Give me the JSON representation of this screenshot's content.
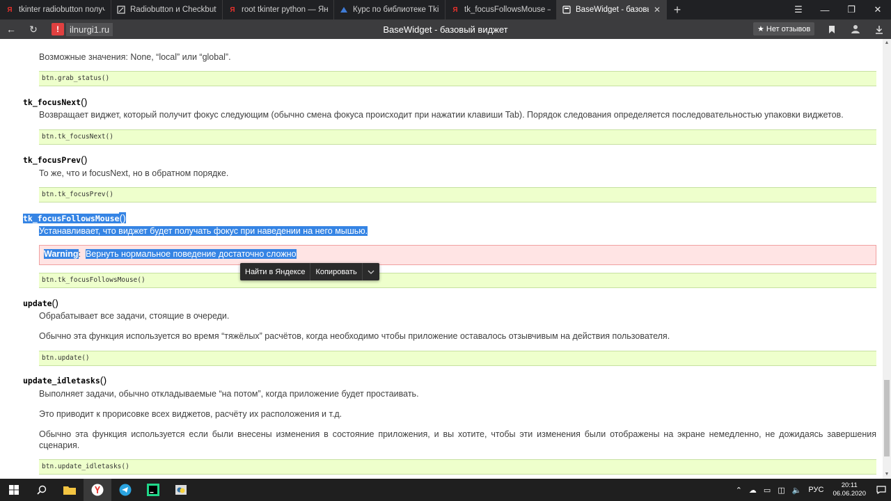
{
  "browser": {
    "tabs": [
      {
        "icon": "yandex-icon",
        "title": "tkinter radiobutton получи",
        "color": "#e8312c"
      },
      {
        "icon": "doc-icon",
        "title": "Radiobutton и Checkbutton",
        "color": "#ffffff"
      },
      {
        "icon": "yandex-icon",
        "title": "root tkinter python — Янде",
        "color": "#e8312c"
      },
      {
        "icon": "course-icon",
        "title": "Курс по библиотеке Tkinte",
        "color": "#3f7bd6"
      },
      {
        "icon": "yandex-icon",
        "title": "tk_focusFollowsMouse — Я",
        "color": "#e8312c"
      },
      {
        "icon": "page-icon",
        "title": "BaseWidget - базовый в",
        "color": "#ffffff"
      }
    ],
    "site_host": "ilnurgi1.ru",
    "page_title": "BaseWidget - базовый виджет",
    "reviews_label": "Нет отзывов"
  },
  "content": {
    "p_values": "Возможные значения: None, “local” или “global”.",
    "code_grab": "btn.grab_status()",
    "sig_focusnext": "tk_focusNext",
    "p_focusnext": "Возвращает виджет, который получит фокус следующим (обычно смена фокуса происходит при нажатии клавиши Tab). Порядок следования определяется последовательностью упаковки виджетов.",
    "code_focusnext": "btn.tk_focusNext()",
    "sig_focusprev": "tk_focusPrev",
    "p_focusprev": "То же, что и focusNext, но в обратном порядке.",
    "code_focusprev": "btn.tk_focusPrev()",
    "sig_follows": "tk_focusFollowsMouse",
    "p_follows": "Устанавливает, что виджет будет получать фокус при наведении на него мышью.",
    "warning_label": "Warning",
    "warning_text": "Вернуть нормальное поведение достаточно сложно",
    "code_follows": "btn.tk_focusFollowsMouse()",
    "sig_update": "update",
    "p_update1": "Обрабатывает все задачи, стоящие в очереди.",
    "p_update2": "Обычно эта функция используется во время “тяжёлых” расчётов, когда необходимо чтобы приложение оставалось отзывчивым на действия пользователя.",
    "code_update": "btn.update()",
    "sig_idle": "update_idletasks",
    "p_idle1": "Выполняет задачи, обычно откладываемые “на потом”, когда приложение будет простаивать.",
    "p_idle2": "Это приводит к прорисовке всех виджетов, расчёту их расположения и т.д.",
    "p_idle3": "Обычно эта функция используется если были внесены изменения в состояние приложения, и вы хотите, чтобы эти изменения были отображены на экране немедленно, не дожидаясь завершения сценария.",
    "code_idle": "btn.update_idletasks()"
  },
  "context_menu": {
    "search": "Найти в Яндексе",
    "copy": "Копировать"
  },
  "taskbar": {
    "lang": "РУС",
    "time": "20:11",
    "date": "06.06.2020"
  },
  "colors": {
    "code_bg": "#eeffcc",
    "selection": "#3584e4",
    "warning_bg": "#ffe4e4"
  }
}
